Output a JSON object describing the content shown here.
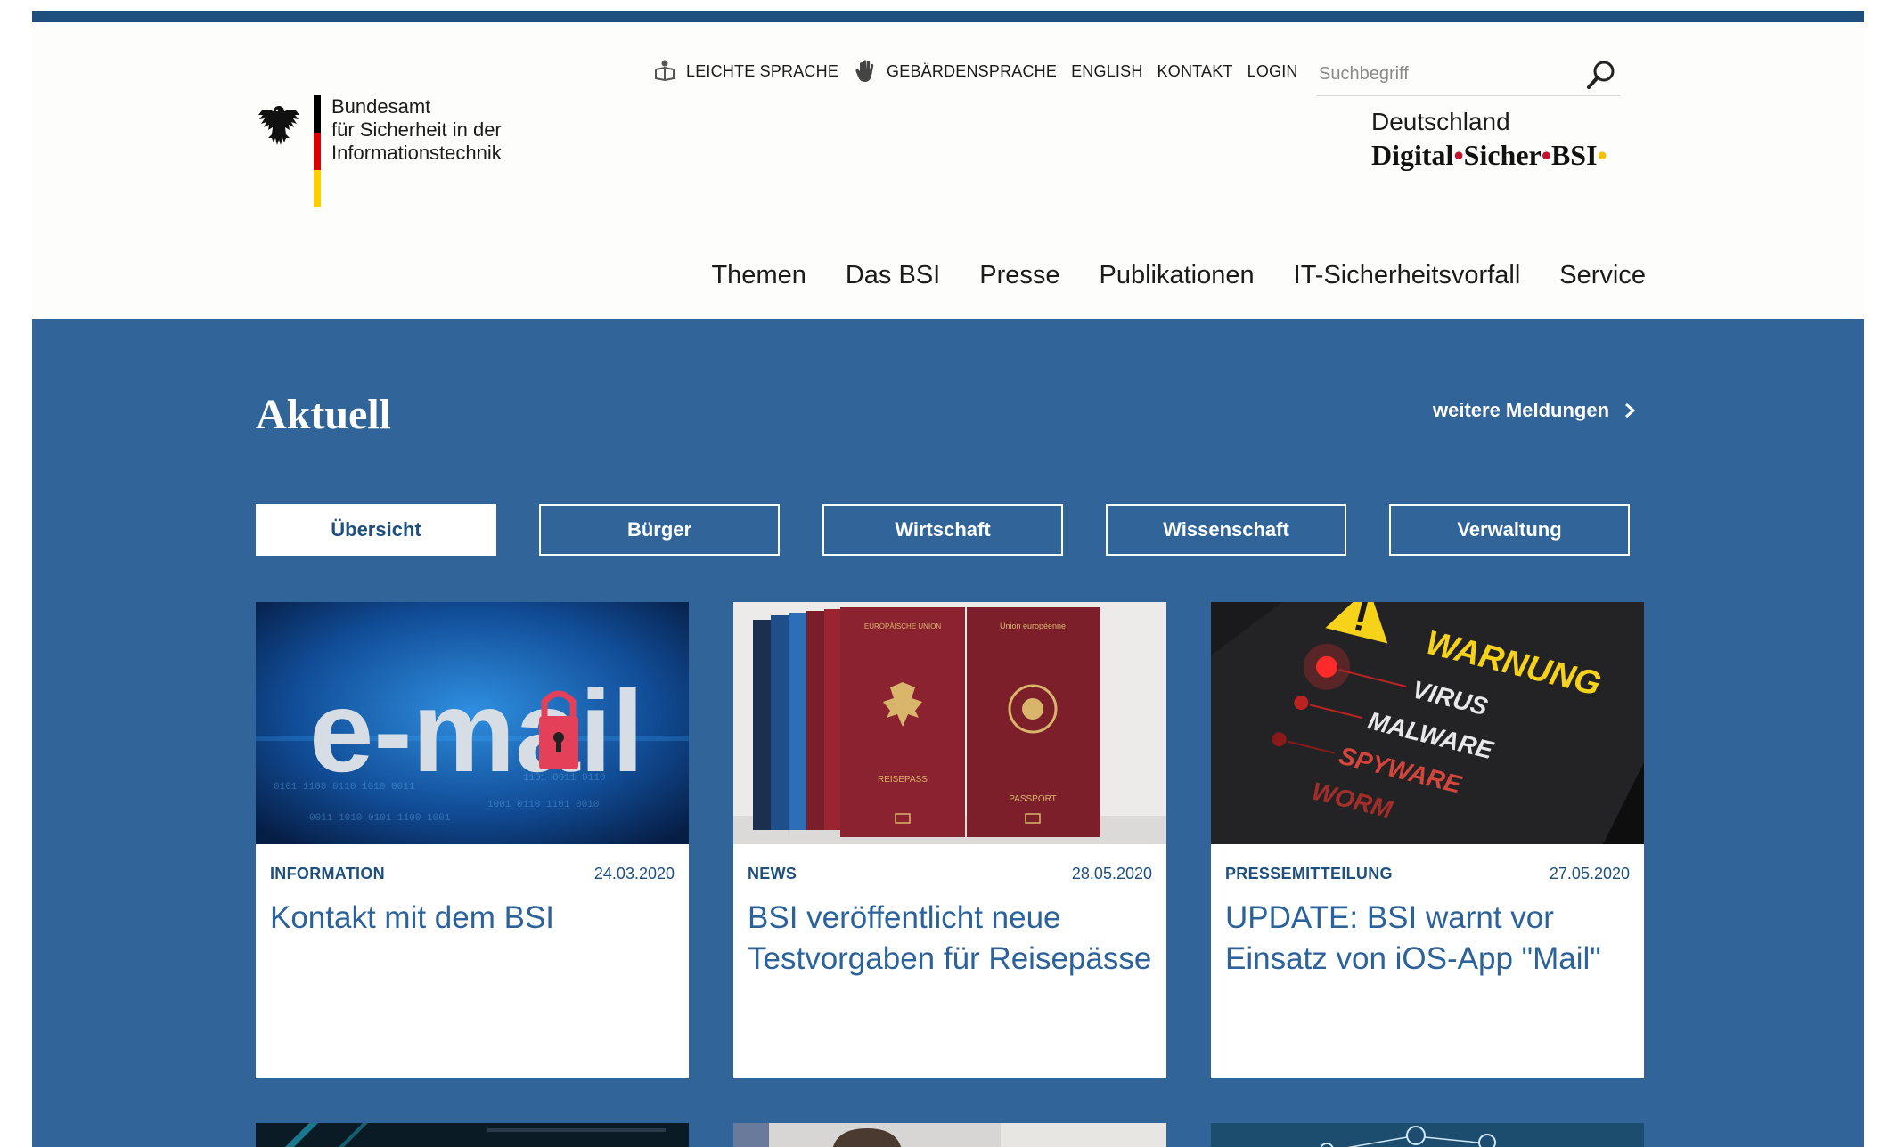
{
  "logo": {
    "lines": [
      "Bundesamt",
      "für Sicherheit in der",
      "Informationstechnik"
    ],
    "flag_colors": [
      "#000000",
      "#dd0000",
      "#ffce00"
    ]
  },
  "metanav": {
    "items": [
      {
        "label": "LEICHTE SPRACHE",
        "icon": "easy-language-icon"
      },
      {
        "label": "GEBÄRDENSPRACHE",
        "icon": "sign-language-hand-icon"
      },
      {
        "label": "ENGLISH"
      },
      {
        "label": "KONTAKT"
      },
      {
        "label": "LOGIN"
      }
    ]
  },
  "search": {
    "placeholder": "Suchbegriff",
    "value": "",
    "icon": "search-icon"
  },
  "campaign": {
    "line1": "Deutschland",
    "line2_parts": [
      "Digital",
      "Sicher",
      "BSI"
    ]
  },
  "mainnav": {
    "items": [
      "Themen",
      "Das BSI",
      "Presse",
      "Publikationen",
      "IT-Sicherheitsvorfall",
      "Service"
    ]
  },
  "aktuell": {
    "title": "Aktuell",
    "more_label": "weitere Meldungen",
    "filters": [
      "Übersicht",
      "Bürger",
      "Wirtschaft",
      "Wissenschaft",
      "Verwaltung"
    ],
    "active_filter": "Übersicht",
    "cards": [
      {
        "category": "INFORMATION",
        "date": "24.03.2020",
        "title": "Kontakt mit dem BSI",
        "image": "e-mail-lock-image",
        "image_text": "e-mail"
      },
      {
        "category": "NEWS",
        "date": "28.05.2020",
        "title": "BSI veröffentlicht neue Testvorgaben für Reisepässe",
        "image": "passports-image",
        "image_text": [
          "REISEPASS",
          "PASSPORT"
        ]
      },
      {
        "category": "PRESSEMITTEILUNG",
        "date": "27.05.2020",
        "title": "UPDATE: BSI warnt vor Einsatz von iOS-App \"Mail\"",
        "image": "warning-virus-image",
        "image_text": [
          "WARNUNG",
          "VIRUS",
          "MALWARE",
          "SPYWARE",
          "WORM"
        ]
      }
    ]
  },
  "colors": {
    "brand_blue": "#31659a",
    "dark_blue": "#1f4f7d",
    "link_blue": "#2c629b"
  }
}
